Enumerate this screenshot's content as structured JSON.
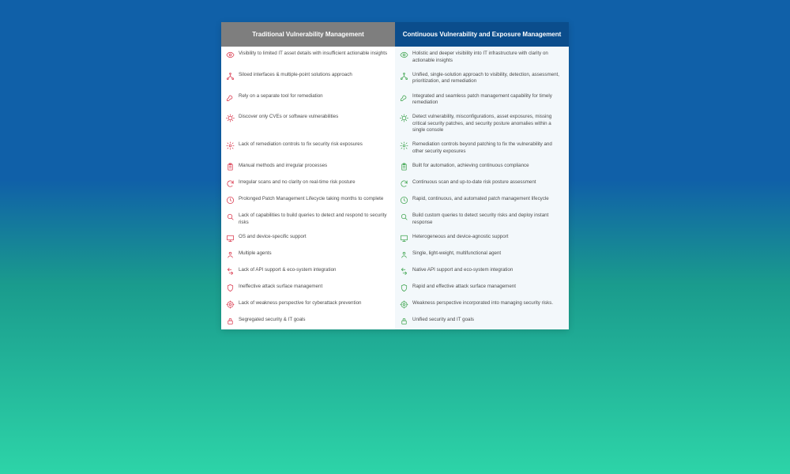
{
  "header": {
    "left": "Traditional Vulnerability Management",
    "right": "Continuous Vulnerability and Exposure Management"
  },
  "rows": [
    {
      "icon": "eye",
      "left": "Visibility to limited IT asset details with insufficient actionable insights",
      "right": "Holistic and deeper visibility into IT infrastructure with clarity on actionable insights"
    },
    {
      "icon": "network",
      "left": "Siloed interfaces & multiple-point solutions approach",
      "right": "Unified, single-solution approach to visibility, detection, assessment, prioritization, and remediation"
    },
    {
      "icon": "wrench",
      "left": "Rely on a separate tool for remediation",
      "right": "Integrated and seamless patch management capability for timely remediation"
    },
    {
      "icon": "bug",
      "left": "Discover only CVEs or software vulnerabilities",
      "right": "Detect vulnerability, misconfigurations, asset exposures, missing critical security patches, and security posture anomalies within a single console"
    },
    {
      "icon": "gear",
      "left": "Lack of remediation controls to fix security risk exposures",
      "right": "Remediation controls beyond patching to fix the vulnerability and other security exposures"
    },
    {
      "icon": "clipboard",
      "left": "Manual methods and irregular processes",
      "right": "Built for automation, achieving continuous compliance"
    },
    {
      "icon": "refresh",
      "left": "Irregular scans and no clarity on real-time risk posture",
      "right": "Continuous scan and up-to-date risk posture assessment"
    },
    {
      "icon": "clock",
      "left": "Prolonged Patch Management Lifecycle taking months to complete",
      "right": "Rapid, continuous, and automated patch management lifecycle"
    },
    {
      "icon": "search",
      "left": "Lack of capabilities to build queries to detect and respond to security risks",
      "right": "Build custom queries to detect security risks and deploy instant response"
    },
    {
      "icon": "device",
      "left": "OS and device-specific support",
      "right": "Heterogeneous and device-agnostic support"
    },
    {
      "icon": "agent",
      "left": "Multiple agents",
      "right": "Single, light-weight, multifunctional agent"
    },
    {
      "icon": "api",
      "left": "Lack of API support & eco-system integration",
      "right": "Native API support and eco-system integration"
    },
    {
      "icon": "shield",
      "left": "Ineffective attack surface management",
      "right": "Rapid and effective attack surface management"
    },
    {
      "icon": "target",
      "left": "Lack of weakness perspective for cyberattack prevention",
      "right": "Weakness perspective incorporated into managing security risks."
    },
    {
      "icon": "lock",
      "left": "Segregated security & IT goals",
      "right": "Unified security and IT goals"
    }
  ]
}
